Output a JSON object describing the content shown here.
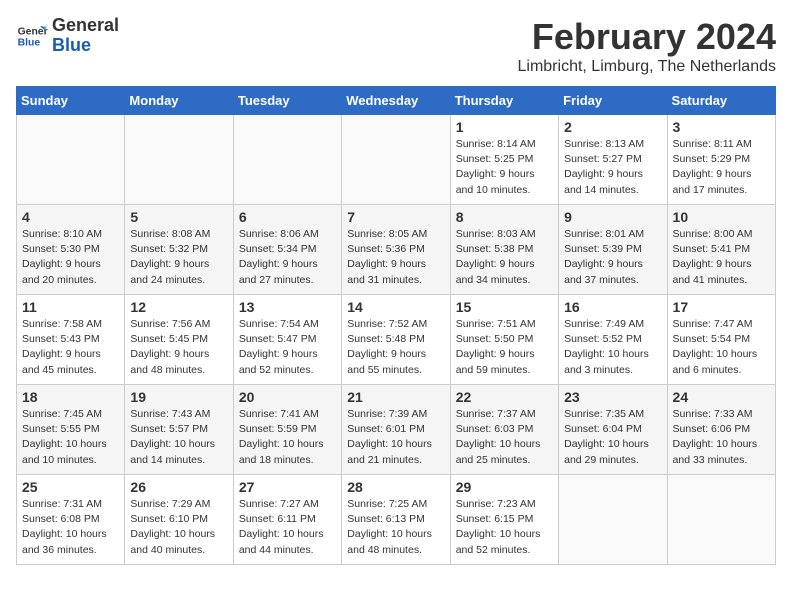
{
  "header": {
    "logo_line1": "General",
    "logo_line2": "Blue",
    "month_year": "February 2024",
    "location": "Limbricht, Limburg, The Netherlands"
  },
  "days_of_week": [
    "Sunday",
    "Monday",
    "Tuesday",
    "Wednesday",
    "Thursday",
    "Friday",
    "Saturday"
  ],
  "weeks": [
    [
      {
        "day": "",
        "info": ""
      },
      {
        "day": "",
        "info": ""
      },
      {
        "day": "",
        "info": ""
      },
      {
        "day": "",
        "info": ""
      },
      {
        "day": "1",
        "info": "Sunrise: 8:14 AM\nSunset: 5:25 PM\nDaylight: 9 hours\nand 10 minutes."
      },
      {
        "day": "2",
        "info": "Sunrise: 8:13 AM\nSunset: 5:27 PM\nDaylight: 9 hours\nand 14 minutes."
      },
      {
        "day": "3",
        "info": "Sunrise: 8:11 AM\nSunset: 5:29 PM\nDaylight: 9 hours\nand 17 minutes."
      }
    ],
    [
      {
        "day": "4",
        "info": "Sunrise: 8:10 AM\nSunset: 5:30 PM\nDaylight: 9 hours\nand 20 minutes."
      },
      {
        "day": "5",
        "info": "Sunrise: 8:08 AM\nSunset: 5:32 PM\nDaylight: 9 hours\nand 24 minutes."
      },
      {
        "day": "6",
        "info": "Sunrise: 8:06 AM\nSunset: 5:34 PM\nDaylight: 9 hours\nand 27 minutes."
      },
      {
        "day": "7",
        "info": "Sunrise: 8:05 AM\nSunset: 5:36 PM\nDaylight: 9 hours\nand 31 minutes."
      },
      {
        "day": "8",
        "info": "Sunrise: 8:03 AM\nSunset: 5:38 PM\nDaylight: 9 hours\nand 34 minutes."
      },
      {
        "day": "9",
        "info": "Sunrise: 8:01 AM\nSunset: 5:39 PM\nDaylight: 9 hours\nand 37 minutes."
      },
      {
        "day": "10",
        "info": "Sunrise: 8:00 AM\nSunset: 5:41 PM\nDaylight: 9 hours\nand 41 minutes."
      }
    ],
    [
      {
        "day": "11",
        "info": "Sunrise: 7:58 AM\nSunset: 5:43 PM\nDaylight: 9 hours\nand 45 minutes."
      },
      {
        "day": "12",
        "info": "Sunrise: 7:56 AM\nSunset: 5:45 PM\nDaylight: 9 hours\nand 48 minutes."
      },
      {
        "day": "13",
        "info": "Sunrise: 7:54 AM\nSunset: 5:47 PM\nDaylight: 9 hours\nand 52 minutes."
      },
      {
        "day": "14",
        "info": "Sunrise: 7:52 AM\nSunset: 5:48 PM\nDaylight: 9 hours\nand 55 minutes."
      },
      {
        "day": "15",
        "info": "Sunrise: 7:51 AM\nSunset: 5:50 PM\nDaylight: 9 hours\nand 59 minutes."
      },
      {
        "day": "16",
        "info": "Sunrise: 7:49 AM\nSunset: 5:52 PM\nDaylight: 10 hours\nand 3 minutes."
      },
      {
        "day": "17",
        "info": "Sunrise: 7:47 AM\nSunset: 5:54 PM\nDaylight: 10 hours\nand 6 minutes."
      }
    ],
    [
      {
        "day": "18",
        "info": "Sunrise: 7:45 AM\nSunset: 5:55 PM\nDaylight: 10 hours\nand 10 minutes."
      },
      {
        "day": "19",
        "info": "Sunrise: 7:43 AM\nSunset: 5:57 PM\nDaylight: 10 hours\nand 14 minutes."
      },
      {
        "day": "20",
        "info": "Sunrise: 7:41 AM\nSunset: 5:59 PM\nDaylight: 10 hours\nand 18 minutes."
      },
      {
        "day": "21",
        "info": "Sunrise: 7:39 AM\nSunset: 6:01 PM\nDaylight: 10 hours\nand 21 minutes."
      },
      {
        "day": "22",
        "info": "Sunrise: 7:37 AM\nSunset: 6:03 PM\nDaylight: 10 hours\nand 25 minutes."
      },
      {
        "day": "23",
        "info": "Sunrise: 7:35 AM\nSunset: 6:04 PM\nDaylight: 10 hours\nand 29 minutes."
      },
      {
        "day": "24",
        "info": "Sunrise: 7:33 AM\nSunset: 6:06 PM\nDaylight: 10 hours\nand 33 minutes."
      }
    ],
    [
      {
        "day": "25",
        "info": "Sunrise: 7:31 AM\nSunset: 6:08 PM\nDaylight: 10 hours\nand 36 minutes."
      },
      {
        "day": "26",
        "info": "Sunrise: 7:29 AM\nSunset: 6:10 PM\nDaylight: 10 hours\nand 40 minutes."
      },
      {
        "day": "27",
        "info": "Sunrise: 7:27 AM\nSunset: 6:11 PM\nDaylight: 10 hours\nand 44 minutes."
      },
      {
        "day": "28",
        "info": "Sunrise: 7:25 AM\nSunset: 6:13 PM\nDaylight: 10 hours\nand 48 minutes."
      },
      {
        "day": "29",
        "info": "Sunrise: 7:23 AM\nSunset: 6:15 PM\nDaylight: 10 hours\nand 52 minutes."
      },
      {
        "day": "",
        "info": ""
      },
      {
        "day": "",
        "info": ""
      }
    ]
  ]
}
